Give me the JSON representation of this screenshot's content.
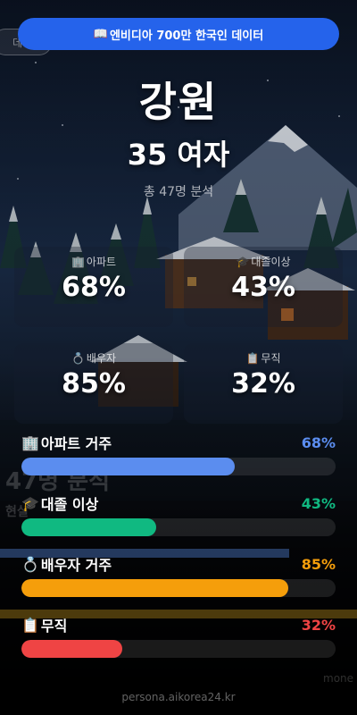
{
  "banner": {
    "icon": "book-icon",
    "text": "엔비디아 700만 한국인 데이터"
  },
  "ghost_chip": "데이",
  "header": {
    "region": "강원",
    "persona": "35 여자",
    "sample": "총 47명 분석"
  },
  "cards": [
    {
      "icon": "building-icon",
      "label": "아파트",
      "value": "68%"
    },
    {
      "icon": "graduation-cap-icon",
      "label": "대졸이상",
      "value": "43%"
    },
    {
      "icon": "ring-icon",
      "label": "배우자",
      "value": "85%"
    },
    {
      "icon": "clipboard-icon",
      "label": "무직",
      "value": "32%"
    }
  ],
  "ghost_overlay": {
    "title": "47명 분석",
    "sub": "현실"
  },
  "bars": [
    {
      "icon": "building-icon",
      "label": "아파트 거주",
      "pct_label": "68%",
      "value": 0.68,
      "color": "#5b8def"
    },
    {
      "icon": "graduation-cap-icon",
      "label": "대졸 이상",
      "pct_label": "43%",
      "value": 0.43,
      "color": "#10b981"
    },
    {
      "icon": "ring-icon",
      "label": "배우자 거주",
      "pct_label": "85%",
      "value": 0.85,
      "color": "#f59e0b"
    },
    {
      "icon": "clipboard-icon",
      "label": "무직",
      "pct_label": "32%",
      "value": 0.32,
      "color": "#ef4444"
    }
  ],
  "ghost_right": "mone",
  "footer": "persona.aikorea24.kr"
}
